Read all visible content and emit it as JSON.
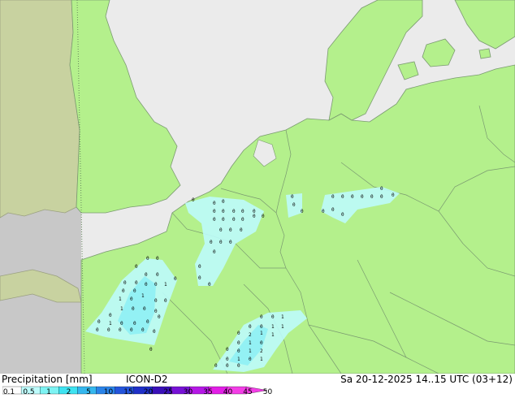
{
  "legend": {
    "title": "Precipitation [mm]",
    "model": "ICON-D2",
    "ticks": [
      "0.1",
      "0.5",
      "1",
      "2",
      "5",
      "10",
      "15",
      "20",
      "25",
      "30",
      "35",
      "40",
      "45",
      "50"
    ],
    "colors": [
      "#fefefe",
      "#bdfbfb",
      "#7df3f3",
      "#3ee3f1",
      "#35b7ee",
      "#2a83e8",
      "#2454db",
      "#1f30c8",
      "#3a10b8",
      "#7712d6",
      "#b518e6",
      "#e21fe6",
      "#f33ee6"
    ]
  },
  "valid_time": "Sa 20-12-2025 14..15 UTC (03+12)",
  "map_colors": {
    "land_domain": "#b4f08c",
    "outside_domain": "#c8c8c8",
    "outside_land": "#c8d2a0",
    "sea": "#ebebeb",
    "border": "#7a9a70",
    "precip_light": "#bdfbfb",
    "precip_mid": "#8ef0f4"
  },
  "cell_labels": [
    {
      "group": "central",
      "values": [
        "0",
        "0",
        "0",
        "0",
        "0",
        "0",
        "0",
        "0",
        "0",
        "0",
        "0",
        "0",
        "0",
        "0",
        "0",
        "0",
        "0",
        "0",
        "0",
        "0",
        "0"
      ]
    },
    {
      "group": "east",
      "values": [
        "0",
        "0",
        "0",
        "0",
        "0",
        "0",
        "0",
        "0",
        "0",
        "0",
        "0",
        "0",
        "0",
        "0"
      ]
    },
    {
      "group": "west",
      "values": [
        "0",
        "0",
        "0",
        "0",
        "0",
        "0",
        "0",
        "0",
        "0",
        "0",
        "0",
        "1",
        "0",
        "1",
        "0",
        "1",
        "0",
        "0",
        "0",
        "1",
        "0",
        "0",
        "0",
        "0",
        "1",
        "0",
        "0",
        "0",
        "0",
        "0",
        "0",
        "0",
        "0",
        "0",
        "0",
        "0",
        "0",
        "0"
      ]
    },
    {
      "group": "south",
      "values": [
        "0",
        "0",
        "1",
        "0",
        "0",
        "1",
        "1",
        "0",
        "2",
        "1",
        "1",
        "0",
        "1",
        "0",
        "0",
        "0",
        "1",
        "2",
        "0",
        "1",
        "0",
        "1",
        "0",
        "0",
        "0",
        "0"
      ]
    }
  ]
}
